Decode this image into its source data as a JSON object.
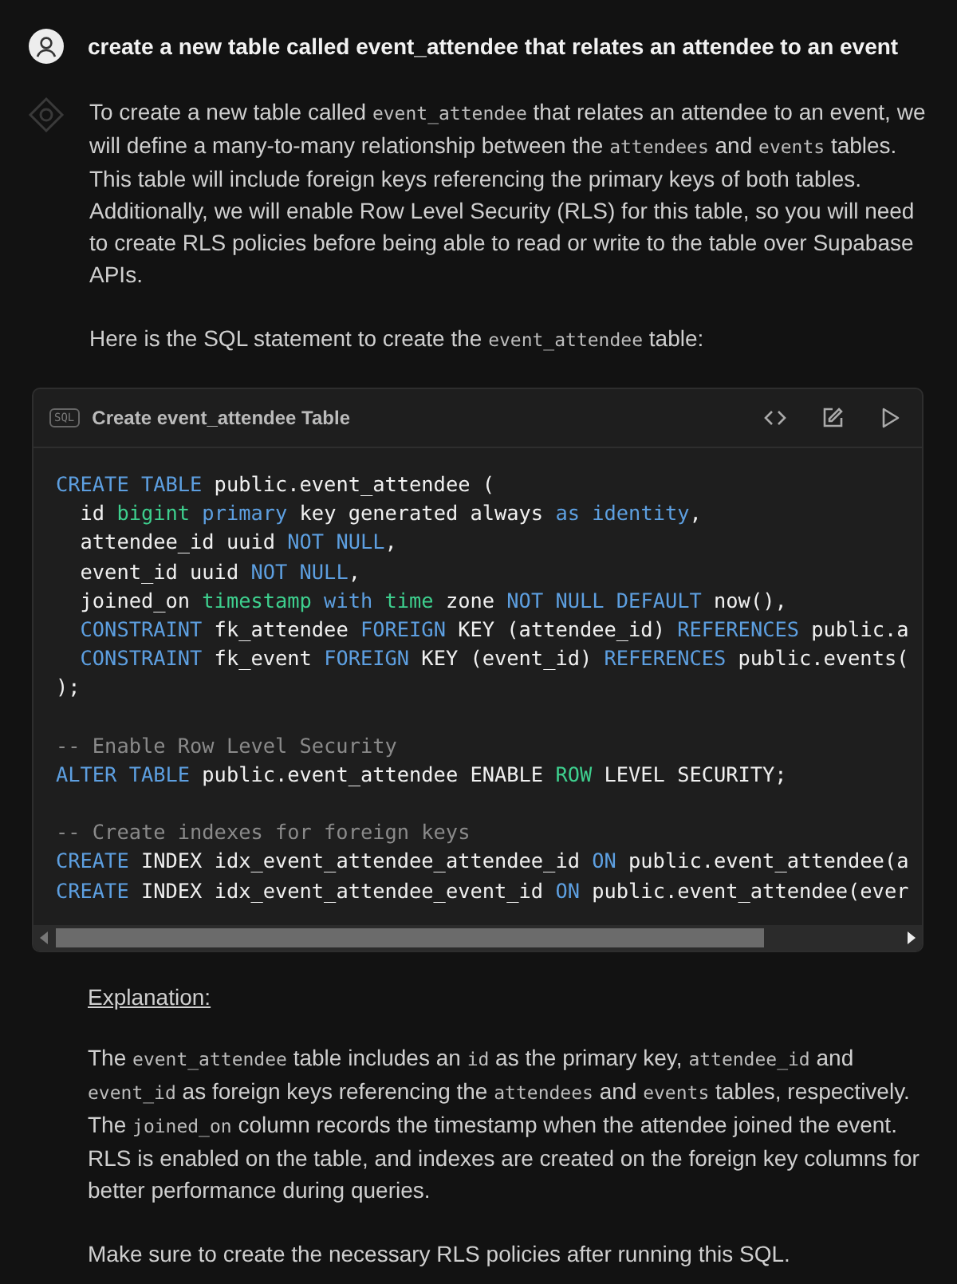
{
  "user_message": {
    "text": "create a new table called event_attendee that relates an attendee to an event"
  },
  "assistant_message": {
    "paragraphs": [
      [
        {
          "text": "To create a new table called ",
          "code": false
        },
        {
          "text": "event_attendee",
          "code": true
        },
        {
          "text": " that relates an attendee to an event, we will define a many-to-many relationship between the ",
          "code": false
        },
        {
          "text": "attendees",
          "code": true
        },
        {
          "text": " and ",
          "code": false
        },
        {
          "text": "events",
          "code": true
        },
        {
          "text": " tables. This table will include foreign keys referencing the primary keys of both tables. Additionally, we will enable Row Level Security (RLS) for this table, so you will need to create RLS policies before being able to read or write to the table over Supabase APIs.",
          "code": false
        }
      ],
      [
        {
          "text": "Here is the SQL statement to create the ",
          "code": false
        },
        {
          "text": "event_attendee",
          "code": true
        },
        {
          "text": " table:",
          "code": false
        }
      ]
    ],
    "code_block": {
      "badge": "SQL",
      "title": "Create event_attendee Table",
      "lines": [
        {
          "blank_before": false,
          "tokens": [
            {
              "kind": "keyword",
              "text": "CREATE TABLE"
            },
            {
              "kind": "plain",
              "text": " public.event_attendee ("
            }
          ]
        },
        {
          "blank_before": false,
          "tokens": [
            {
              "kind": "plain",
              "text": "  id "
            },
            {
              "kind": "type",
              "text": "bigint"
            },
            {
              "kind": "keyword",
              "text": " primary"
            },
            {
              "kind": "plain",
              "text": " key generated always "
            },
            {
              "kind": "keyword",
              "text": "as identity"
            },
            {
              "kind": "plain",
              "text": ","
            }
          ]
        },
        {
          "blank_before": false,
          "tokens": [
            {
              "kind": "plain",
              "text": "  attendee_id uuid "
            },
            {
              "kind": "keyword",
              "text": "NOT NULL"
            },
            {
              "kind": "plain",
              "text": ","
            }
          ]
        },
        {
          "blank_before": false,
          "tokens": [
            {
              "kind": "plain",
              "text": "  event_id uuid "
            },
            {
              "kind": "keyword",
              "text": "NOT NULL"
            },
            {
              "kind": "plain",
              "text": ","
            }
          ]
        },
        {
          "blank_before": false,
          "tokens": [
            {
              "kind": "plain",
              "text": "  joined_on "
            },
            {
              "kind": "type",
              "text": "timestamp"
            },
            {
              "kind": "keyword",
              "text": " with"
            },
            {
              "kind": "type",
              "text": " time"
            },
            {
              "kind": "plain",
              "text": " zone "
            },
            {
              "kind": "keyword",
              "text": "NOT NULL DEFAULT"
            },
            {
              "kind": "plain",
              "text": " now(),"
            }
          ]
        },
        {
          "blank_before": false,
          "tokens": [
            {
              "kind": "keyword",
              "text": "  CONSTRAINT"
            },
            {
              "kind": "plain",
              "text": " fk_attendee "
            },
            {
              "kind": "keyword",
              "text": "FOREIGN"
            },
            {
              "kind": "plain",
              "text": " KEY (attendee_id) "
            },
            {
              "kind": "keyword",
              "text": "REFERENCES"
            },
            {
              "kind": "plain",
              "text": " public.a"
            }
          ]
        },
        {
          "blank_before": false,
          "tokens": [
            {
              "kind": "keyword",
              "text": "  CONSTRAINT"
            },
            {
              "kind": "plain",
              "text": " fk_event "
            },
            {
              "kind": "keyword",
              "text": "FOREIGN"
            },
            {
              "kind": "plain",
              "text": " KEY (event_id) "
            },
            {
              "kind": "keyword",
              "text": "REFERENCES"
            },
            {
              "kind": "plain",
              "text": " public.events("
            }
          ]
        },
        {
          "blank_before": false,
          "tokens": [
            {
              "kind": "plain",
              "text": ");"
            }
          ]
        },
        {
          "blank_before": true,
          "tokens": [
            {
              "kind": "comment",
              "text": "-- Enable Row Level Security"
            }
          ]
        },
        {
          "blank_before": false,
          "tokens": [
            {
              "kind": "keyword",
              "text": "ALTER TABLE"
            },
            {
              "kind": "plain",
              "text": " public.event_attendee ENABLE "
            },
            {
              "kind": "type",
              "text": "ROW"
            },
            {
              "kind": "plain",
              "text": " LEVEL SECURITY;"
            }
          ]
        },
        {
          "blank_before": true,
          "tokens": [
            {
              "kind": "comment",
              "text": "-- Create indexes for foreign keys"
            }
          ]
        },
        {
          "blank_before": false,
          "tokens": [
            {
              "kind": "keyword",
              "text": "CREATE"
            },
            {
              "kind": "plain",
              "text": " INDEX idx_event_attendee_attendee_id "
            },
            {
              "kind": "keyword",
              "text": "ON"
            },
            {
              "kind": "plain",
              "text": " public.event_attendee(a"
            }
          ]
        },
        {
          "blank_before": false,
          "tokens": [
            {
              "kind": "keyword",
              "text": "CREATE"
            },
            {
              "kind": "plain",
              "text": " INDEX idx_event_attendee_event_id "
            },
            {
              "kind": "keyword",
              "text": "ON"
            },
            {
              "kind": "plain",
              "text": " public.event_attendee(ever"
            }
          ]
        }
      ]
    },
    "heading": "Explanation:",
    "after_paragraphs": [
      [
        {
          "text": "The ",
          "code": false
        },
        {
          "text": "event_attendee",
          "code": true
        },
        {
          "text": " table includes an ",
          "code": false
        },
        {
          "text": "id",
          "code": true
        },
        {
          "text": " as the primary key, ",
          "code": false
        },
        {
          "text": "attendee_id",
          "code": true
        },
        {
          "text": " and ",
          "code": false
        },
        {
          "text": "event_id",
          "code": true
        },
        {
          "text": " as foreign keys referencing the ",
          "code": false
        },
        {
          "text": "attendees",
          "code": true
        },
        {
          "text": " and ",
          "code": false
        },
        {
          "text": "events",
          "code": true
        },
        {
          "text": " tables, respectively. The ",
          "code": false
        },
        {
          "text": "joined_on",
          "code": true
        },
        {
          "text": " column records the timestamp when the attendee joined the event. RLS is enabled on the table, and indexes are created on the foreign key columns for better performance during queries.",
          "code": false
        }
      ],
      [
        {
          "text": "Make sure to create the necessary RLS policies after running this SQL.",
          "code": false
        }
      ]
    ]
  }
}
